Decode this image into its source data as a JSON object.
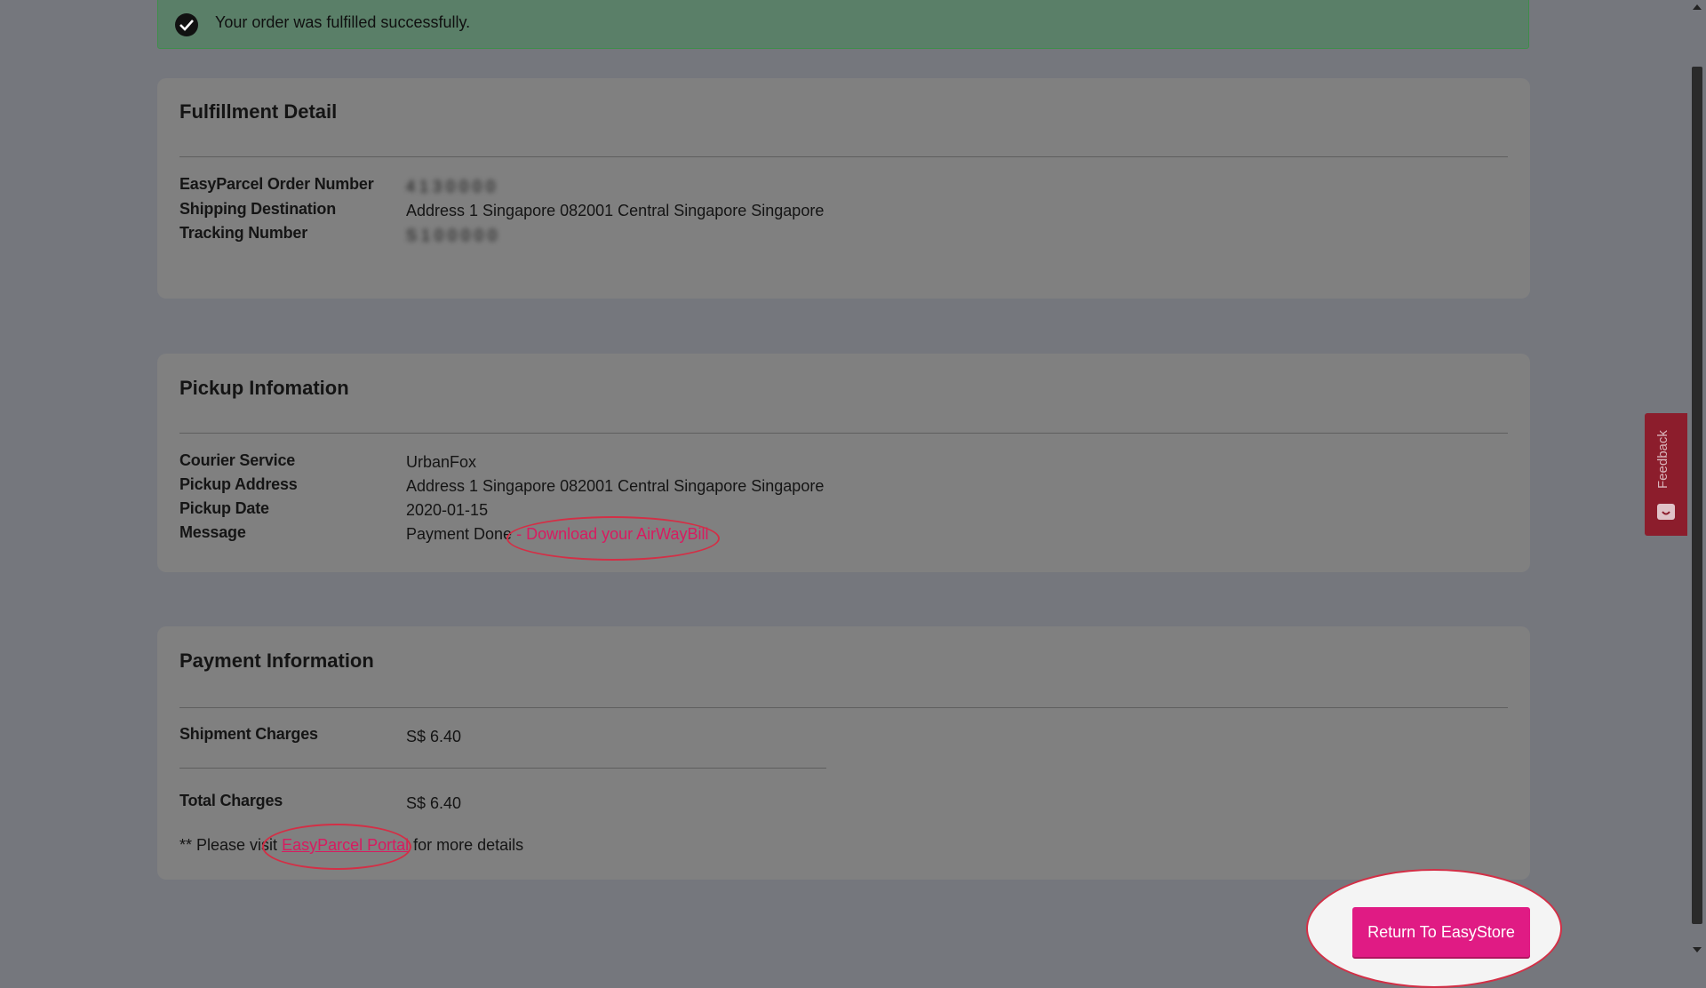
{
  "alert": {
    "message": "Your order was fulfilled successfully."
  },
  "fulfillment": {
    "title": "Fulfillment Detail",
    "rows": [
      {
        "label": "EasyParcel Order Number",
        "value": "4 1 3 0 0 0 0"
      },
      {
        "label": "Shipping Destination",
        "value": "Address 1 Singapore 082001 Central Singapore Singapore"
      },
      {
        "label": "Tracking Number",
        "value": "S 1 0 0 0 0 0"
      }
    ]
  },
  "pickup": {
    "title": "Pickup Infomation",
    "rows": [
      {
        "label": "Courier Service",
        "value": "UrbanFox"
      },
      {
        "label": "Pickup Address",
        "value": "Address 1 Singapore 082001 Central Singapore Singapore"
      },
      {
        "label": "Pickup Date",
        "value": "2020-01-15"
      },
      {
        "label": "Message",
        "value": "Payment Done",
        "link_prefix": " - ",
        "link": "Download your AirWayBill"
      }
    ]
  },
  "payment": {
    "title": "Payment Information",
    "shipment_label": "Shipment Charges",
    "shipment_value": "S$ 6.40",
    "total_label": "Total Charges",
    "total_value": "S$ 6.40",
    "note_prefix": "** Please visit ",
    "note_link": "EasyParcel Portal",
    "note_suffix": " for more details"
  },
  "return_button": "Return To EasyStore",
  "feedback": {
    "label": "Feedback",
    "icon": "smile-icon"
  },
  "colors": {
    "accent": "#e01b84",
    "link": "#d81b60",
    "success": "#5a7f68",
    "annotation": "#d32f46"
  }
}
